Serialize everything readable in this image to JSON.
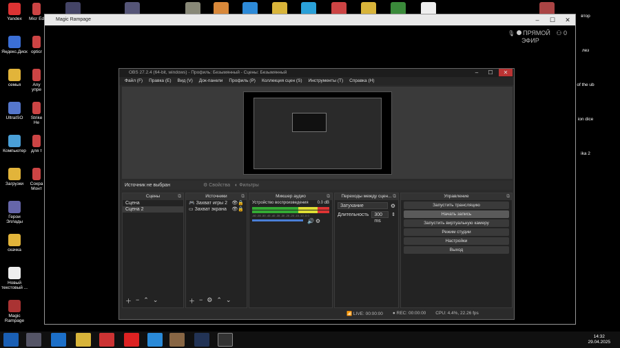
{
  "desktop_icons": [
    {
      "label": "Yandex",
      "color": "#d33"
    },
    {
      "label": "Яндекс.Диск",
      "color": "#3b6fd6"
    },
    {
      "label": "семья",
      "color": "#e2b43a"
    },
    {
      "label": "UltraISO",
      "color": "#5577cc"
    },
    {
      "label": "Компьютер",
      "color": "#4aa0d8"
    },
    {
      "label": "Загрузки",
      "color": "#e2b43a"
    },
    {
      "label": "Герои Эллады",
      "color": "#66a"
    },
    {
      "label": "скачка",
      "color": "#e2b43a"
    },
    {
      "label": "Новый текстовый ...",
      "color": "#eee"
    },
    {
      "label": "Magic Rampage",
      "color": "#a33"
    }
  ],
  "desktop_icons_col2": [
    "Micr Ed",
    "opticr",
    "Any упре",
    "Strike He",
    "для т",
    "Сохра Монт"
  ],
  "desktop_icons_right": [
    "втор",
    "лез",
    "of the ub",
    "ion dice",
    "ika 2"
  ],
  "magic_rampage": {
    "title": "Magic Rampage",
    "live_line1": "ПРЯМОЙ",
    "live_line2": "ЭФИР",
    "viewers": "0"
  },
  "obs": {
    "title": "OBS 27.2.4 (64-bit, windows) - Профиль: Безымянный - Сцены: Безымянный",
    "menu": [
      "Файл (F)",
      "Правка (E)",
      "Вид (V)",
      "Док-панели",
      "Профиль (P)",
      "Коллекция сцен (S)",
      "Инструменты (T)",
      "Справка (H)"
    ],
    "source_status": "Источник не выбран",
    "properties": "Свойства",
    "filters": "Фильтры",
    "scenes": {
      "title": "Сцены",
      "items": [
        "Сцена",
        "Сцена 2"
      ]
    },
    "sources": {
      "title": "Источники",
      "items": [
        "Захват игры 2",
        "Захват экрана"
      ]
    },
    "mixer": {
      "title": "Микшер аудио",
      "channel": "Устройство воспроизведения",
      "level": "0.0 dB",
      "ticks": "-60 -55 -50 -45 -40 -35 -30 -25 -20 -15 -10 -5 0"
    },
    "transitions": {
      "title": "Переходы между сцен...",
      "type": "Затухание",
      "duration_label": "Длительность",
      "duration": "300 ms"
    },
    "controls": {
      "title": "Управление",
      "buttons": [
        "Запустить трансляцию",
        "Начать запись",
        "Запустить виртуальную камеру",
        "Режим студии",
        "Настройки",
        "Выход"
      ]
    },
    "status": {
      "live": "LIVE: 00:00:00",
      "rec": "REC: 00:00:00",
      "cpu": "CPU: 4.4%, 22.26 fps"
    }
  },
  "taskbar": {
    "time": "14:32",
    "date": "29.04.2025"
  }
}
